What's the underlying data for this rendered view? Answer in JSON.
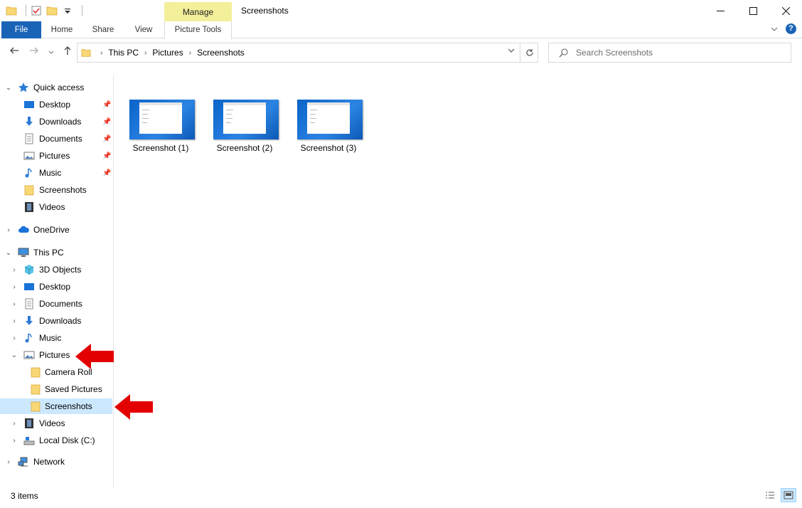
{
  "window": {
    "title": "Screenshots",
    "contextual_tab": "Manage",
    "minimize_icon": "minimize-icon",
    "maximize_icon": "maximize-icon",
    "close_icon": "close-icon"
  },
  "ribbon": {
    "file": "File",
    "home": "Home",
    "share": "Share",
    "view": "View",
    "picture_tools": "Picture Tools",
    "help": "?"
  },
  "address": {
    "crumbs": [
      "This PC",
      "Pictures",
      "Screenshots"
    ]
  },
  "search": {
    "placeholder": "Search Screenshots"
  },
  "navpane": {
    "quick_access": "Quick access",
    "quick_items": [
      "Desktop",
      "Downloads",
      "Documents",
      "Pictures",
      "Music",
      "Screenshots",
      "Videos"
    ],
    "onedrive": "OneDrive",
    "this_pc": "This PC",
    "pc_items": [
      "3D Objects",
      "Desktop",
      "Documents",
      "Downloads",
      "Music",
      "Pictures"
    ],
    "pictures_children": [
      "Camera Roll",
      "Saved Pictures",
      "Screenshots"
    ],
    "pc_items_after": [
      "Videos",
      "Local Disk (C:)"
    ],
    "network": "Network",
    "selected": "Screenshots"
  },
  "files": [
    {
      "name": "Screenshot (1)"
    },
    {
      "name": "Screenshot (2)"
    },
    {
      "name": "Screenshot (3)"
    }
  ],
  "status": {
    "item_count": "3 items"
  },
  "colors": {
    "accent": "#1a64b8",
    "selection": "#cce8ff",
    "manage_tab": "#f4ef9a",
    "annotation_arrow": "#e30000"
  }
}
